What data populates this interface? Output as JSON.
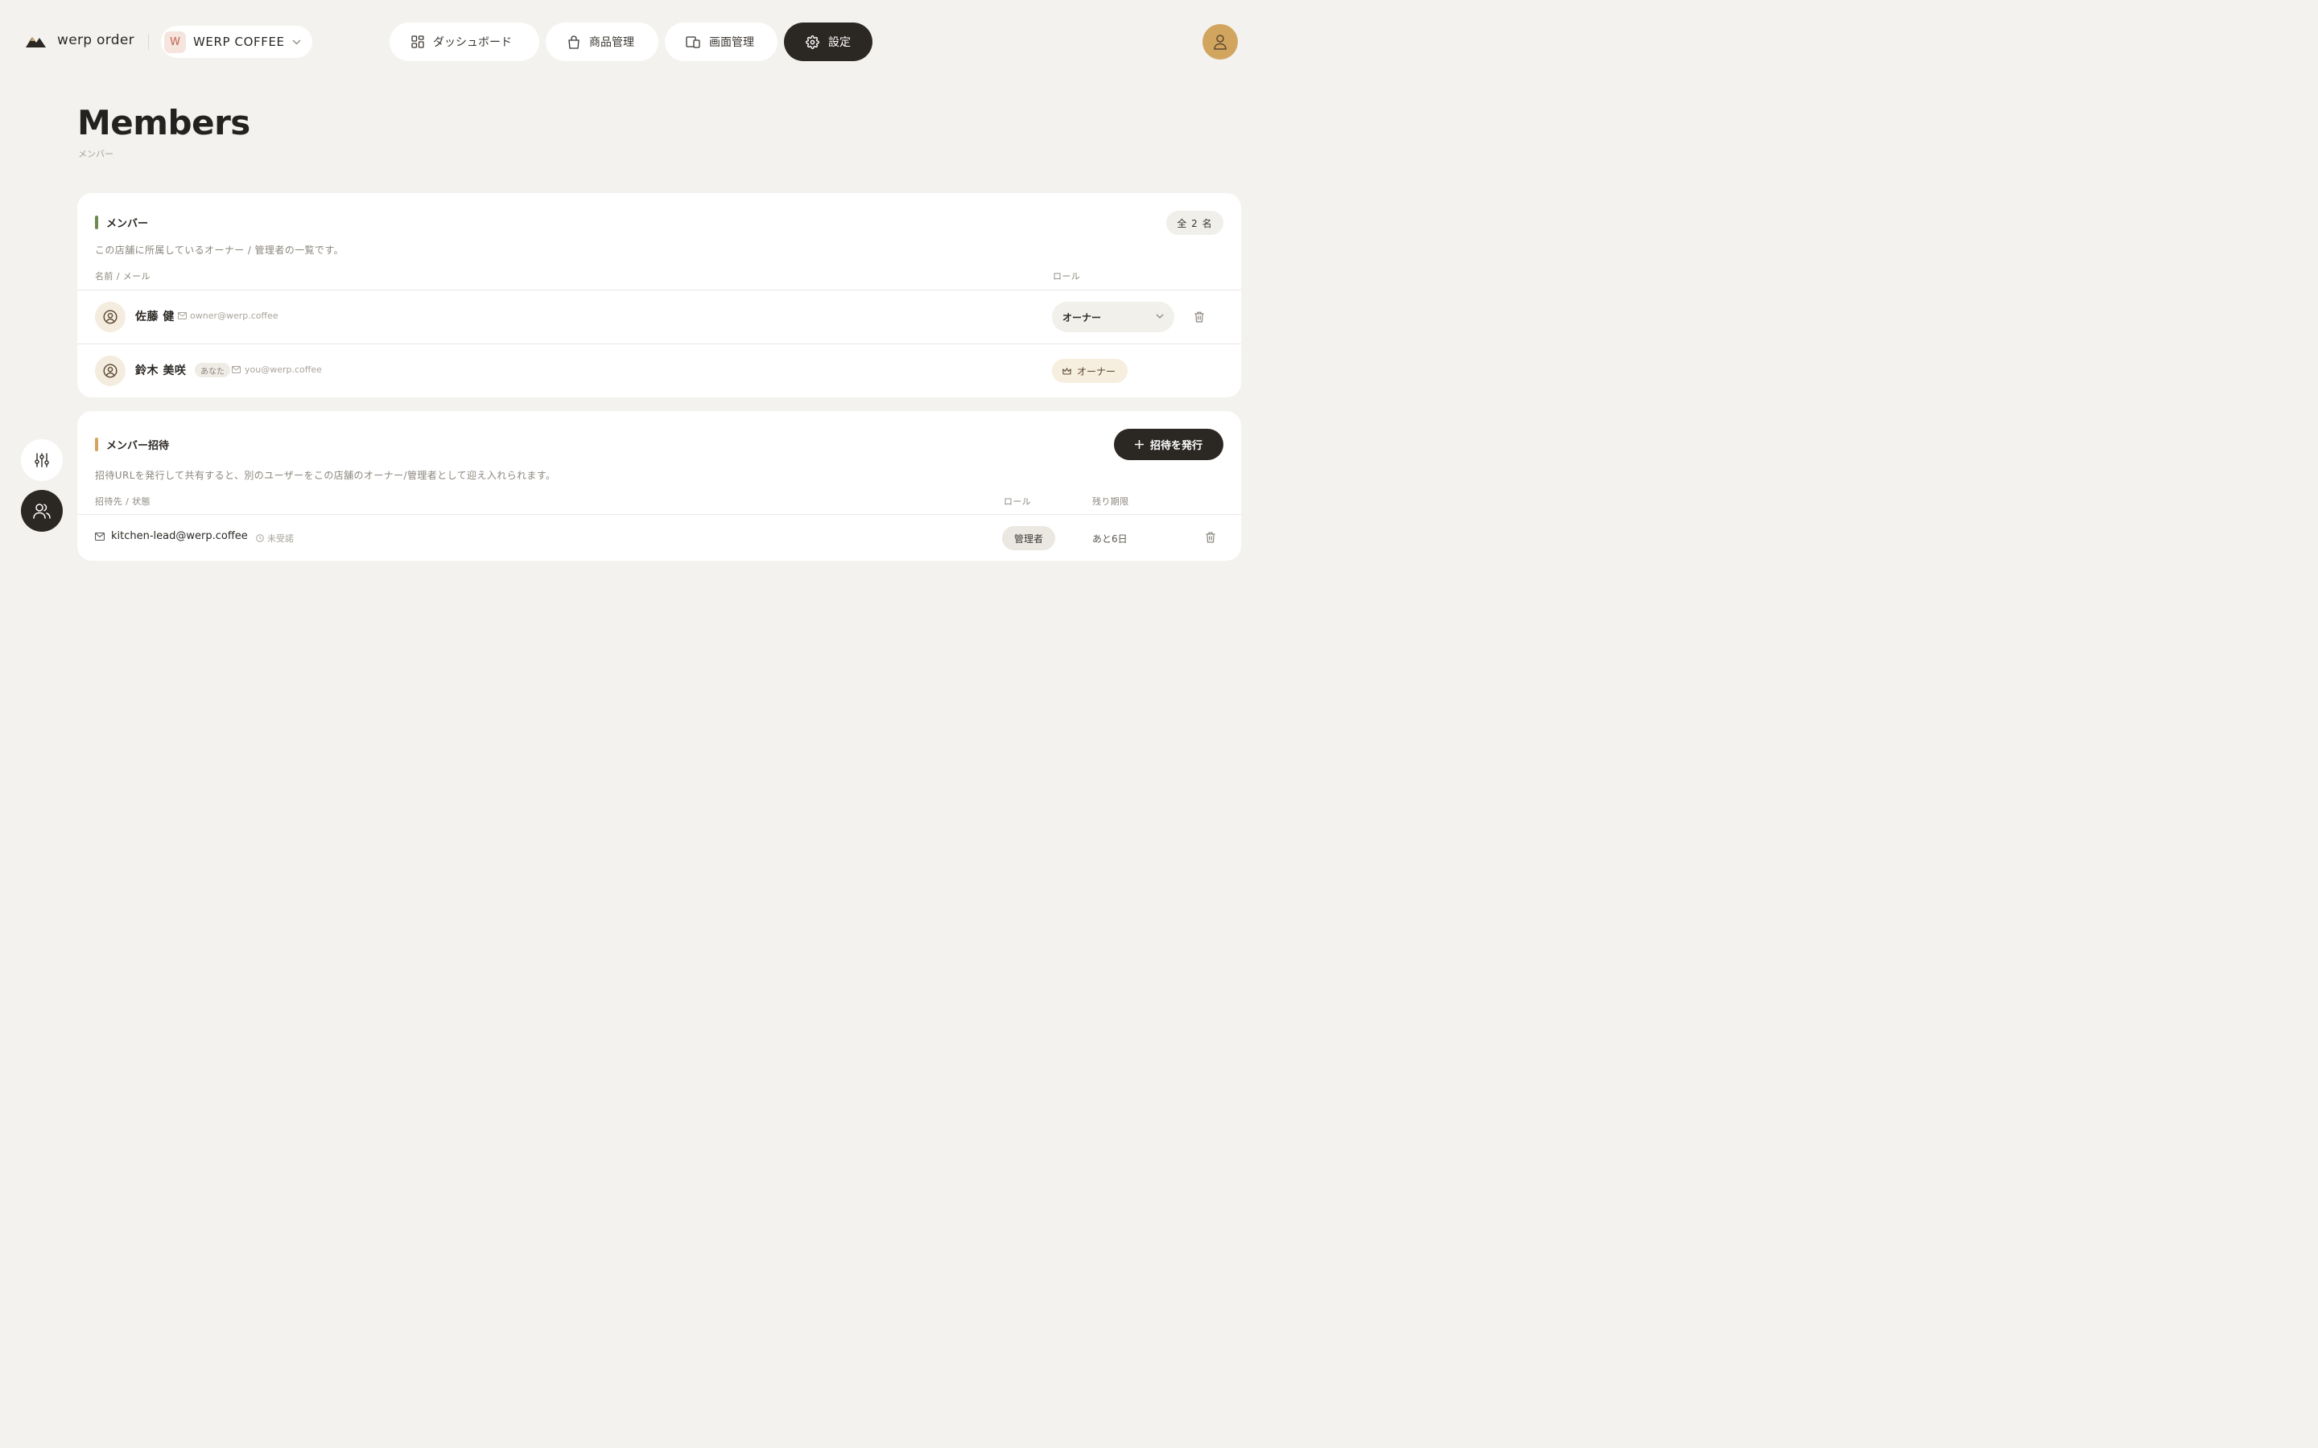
{
  "brand": {
    "name": "werp order"
  },
  "store": {
    "badge": "W",
    "name": "WERP COFFEE"
  },
  "nav": {
    "dashboard": "ダッシュボード",
    "products": "商品管理",
    "screens": "画面管理",
    "settings": "設定",
    "active": "settings"
  },
  "page": {
    "title": "Members",
    "subtitle": "メンバー"
  },
  "members_section": {
    "title": "メンバー",
    "count": "全 2 名",
    "description": "この店舗に所属しているオーナー / 管理者の一覧です。",
    "col_name": "名前 / メール",
    "col_role": "ロール",
    "rows": [
      {
        "name": "佐藤 健",
        "email": "owner@werp.coffee",
        "role": "オーナー",
        "editable": true
      },
      {
        "name": "鈴木 美咲",
        "you_tag": "あなた",
        "email": "you@werp.coffee",
        "role": "オーナー",
        "editable": false
      }
    ]
  },
  "invites_section": {
    "title": "メンバー招待",
    "button": "招待を発行",
    "description": "招待URLを発行して共有すると、別のユーザーをこの店舗のオーナー/管理者として迎え入れられます。",
    "col_target": "招待先 / 状態",
    "col_role": "ロール",
    "col_expire": "残り期限",
    "rows": [
      {
        "email": "kitchen-lead@werp.coffee",
        "status": "未受諾",
        "role": "管理者",
        "expires": "あと6日"
      }
    ]
  },
  "colors": {
    "background": "#f3f2ee",
    "dark": "#2b2824",
    "accent_green": "#6f8a4f",
    "accent_gold": "#d2a55f",
    "avatar": "#d2a55f"
  },
  "icons": {
    "brand": "mountain-logo-icon",
    "dashboard": "grid-icon",
    "products": "bag-icon",
    "screens": "devices-icon",
    "settings": "gear-icon",
    "user": "user-icon",
    "rail_filters": "sliders-icon",
    "rail_members": "users-icon"
  }
}
